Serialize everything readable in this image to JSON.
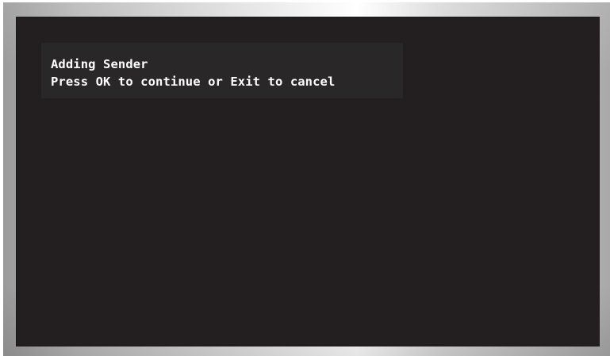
{
  "osd": {
    "title": "Adding Sender",
    "prompt": "Press OK to continue or Exit to cancel"
  }
}
